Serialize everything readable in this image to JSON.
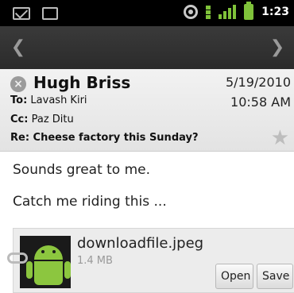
{
  "status_bar": {
    "time": "1:23",
    "icons": [
      "mail-icon",
      "calendar-icon",
      "gps-icon",
      "network-activity-icon",
      "signal-icon",
      "battery-icon"
    ]
  },
  "nav": {
    "prev_icon": "chevron-left-icon",
    "next_icon": "chevron-right-icon"
  },
  "message": {
    "sender": "Hugh Briss",
    "date": "5/19/2010",
    "time": "10:58 AM",
    "to_label": "To:",
    "to": "Lavash Kiri",
    "cc_label": "Cc:",
    "cc": "Paz Ditu",
    "subject": "Re: Cheese factory this Sunday?",
    "body_lines": [
      "Sounds great to me.",
      "Catch me riding this ..."
    ]
  },
  "attachment": {
    "filename": "downloadfile.jpeg",
    "size": "1.4 MB",
    "open_label": "Open",
    "save_label": "Save"
  },
  "colors": {
    "status_green": "#7fc23a",
    "android_green": "#8cc63f"
  }
}
